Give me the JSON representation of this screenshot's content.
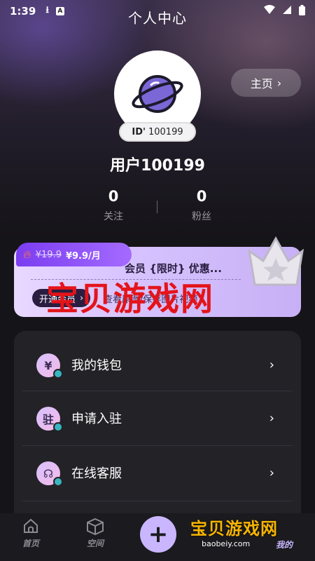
{
  "status_bar": {
    "time": "1:39"
  },
  "header": {
    "title": "个人中心"
  },
  "profile": {
    "id_prefix": "ID'",
    "id_value": "100199",
    "home_label": "主页",
    "username": "用户100199"
  },
  "stats": [
    {
      "value": "0",
      "label": "关注"
    },
    {
      "value": "0",
      "label": "粉丝"
    }
  ],
  "vip": {
    "old_price": "¥19.9",
    "new_price": "¥9.9/月",
    "title": "会员 {限时} 优惠...",
    "open_label": "开通会员",
    "desc": "查看原图/保存图片视频"
  },
  "watermark": {
    "text": "宝贝游戏网",
    "small_text": "宝贝游戏网",
    "domain": "baobeiy.com"
  },
  "menu": [
    {
      "label": "我的钱包",
      "icon_char": "¥"
    },
    {
      "label": "申请入驻",
      "icon_char": "驻"
    },
    {
      "label": "在线客服",
      "icon_char": "☊"
    }
  ],
  "tabs": [
    {
      "label": "首页"
    },
    {
      "label": "空间"
    },
    {
      "label": "我的"
    }
  ],
  "colors": {
    "accent": "#c9b6ff",
    "background": "#151418",
    "watermark_red": "#e4141a"
  }
}
